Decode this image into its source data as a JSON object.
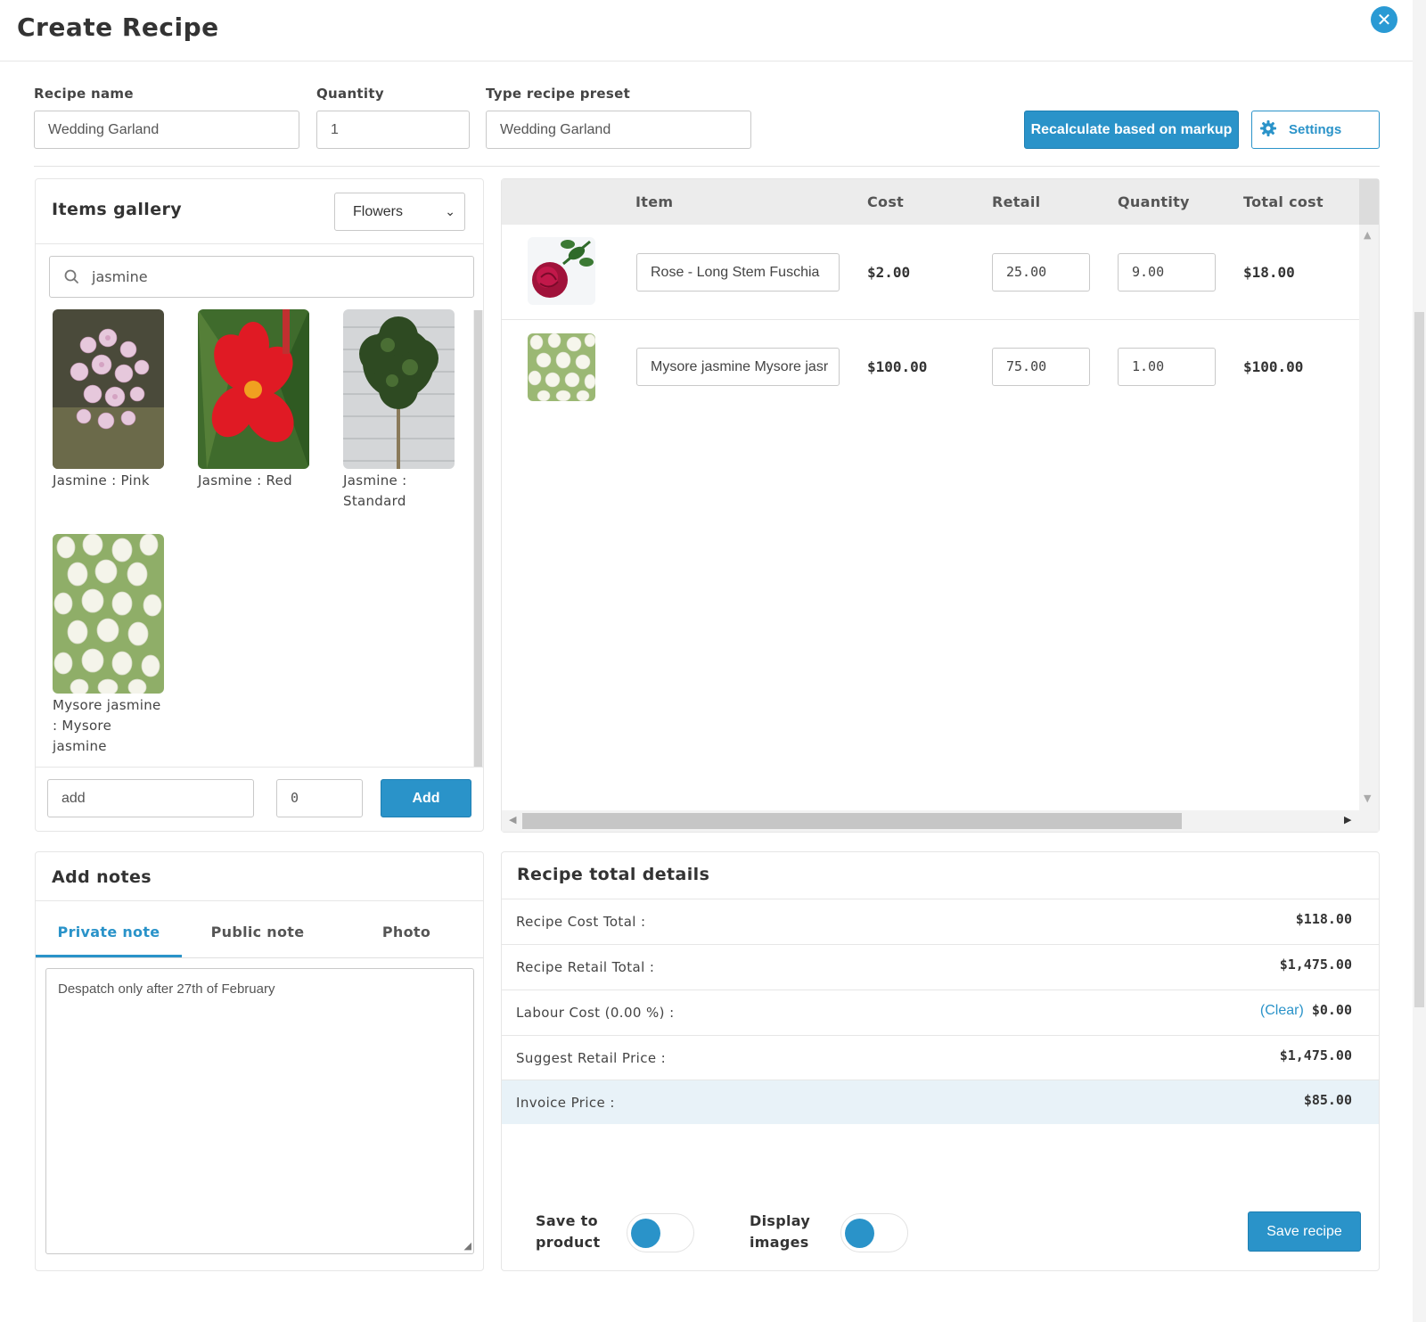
{
  "header": {
    "title": "Create Recipe",
    "close_icon": "close-circle-icon"
  },
  "form": {
    "recipe_name_label": "Recipe name",
    "recipe_name_value": "Wedding Garland",
    "quantity_label": "Quantity",
    "quantity_value": "1",
    "preset_label": "Type recipe preset",
    "preset_value": "Wedding Garland",
    "recalculate_label": "Recalculate based on markup",
    "settings_label": "Settings"
  },
  "gallery": {
    "title": "Items gallery",
    "category_selected": "Flowers",
    "search_value": "jasmine",
    "items": [
      {
        "caption": "Jasmine : Pink"
      },
      {
        "caption": "Jasmine : Red"
      },
      {
        "caption": "Jasmine : Standard"
      },
      {
        "caption": "Mysore jasmine : Mysore jasmine"
      }
    ],
    "add_input_value": "add",
    "add_qty_value": "0",
    "add_button": "Add"
  },
  "table": {
    "columns": [
      "Item",
      "Cost",
      "Retail",
      "Quantity",
      "Total cost"
    ],
    "rows": [
      {
        "item": "Rose - Long Stem Fuschia",
        "cost": "$2.00",
        "retail": "25.00",
        "quantity": "9.00",
        "total": "$18.00"
      },
      {
        "item": "Mysore jasmine Mysore jasr",
        "cost": "$100.00",
        "retail": "75.00",
        "quantity": "1.00",
        "total": "$100.00"
      }
    ]
  },
  "notes": {
    "title": "Add notes",
    "tabs": [
      "Private note",
      "Public note",
      "Photo"
    ],
    "active_tab": "Private note",
    "text": "Despatch only after 27th of February"
  },
  "totals": {
    "title": "Recipe total details",
    "rows": [
      {
        "label": "Recipe Cost Total :",
        "value": "$118.00"
      },
      {
        "label": "Recipe Retail Total :",
        "value": "$1,475.00"
      },
      {
        "label": "Labour Cost (0.00 %) :",
        "clear": "(Clear)",
        "value": "$0.00"
      },
      {
        "label": "Suggest Retail Price :",
        "value": "$1,475.00"
      },
      {
        "label": "Invoice Price :",
        "value": "$85.00"
      }
    ],
    "save_to_product_label": "Save to product",
    "display_images_label": "Display images",
    "save_to_product_on": true,
    "display_images_on": true,
    "save_button": "Save recipe"
  },
  "colors": {
    "accent": "#2a93c9",
    "highlight_row": "#e8f2f8"
  }
}
